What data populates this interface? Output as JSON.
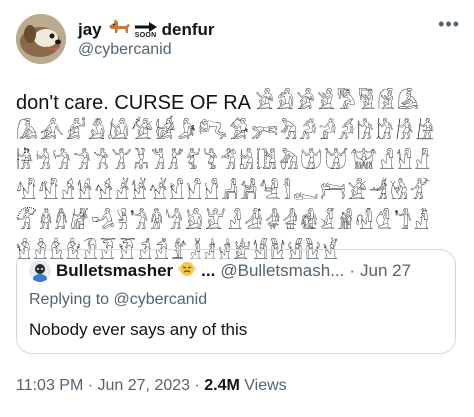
{
  "author": {
    "name": "jay",
    "badge_text": "SOON",
    "name_suffix": "denfur",
    "handle": "@cybercanid",
    "avatar_icon": "dog-photo-avatar",
    "name_icons": [
      "dog-emoji-icon",
      "soon-arrow-icon"
    ]
  },
  "more_icon": "more-options-icon",
  "tweet": {
    "lead_text": "don't care. CURSE OF RA ",
    "hieroglyphs": "𓀀𓀁𓀂𓀃𓀄𓀅𓀆𓀇𓀈𓀉𓀊𓀋𓀌𓀍𓀎𓀏𓀐𓀑𓀒𓀓𓀔𓀕𓀖𓀗𓀘𓀙𓀚𓀛𓀜𓀝𓀞𓀟𓀠𓀡𓀢𓀣𓀤𓀥𓀦𓀧𓀨𓀩𓀪𓀫𓀬𓀭𓀮𓀯𓀰𓀱𓀲𓀳𓀴𓀵𓀶𓀷𓀸𓀹𓀺𓀻𓀼𓀽𓀾𓀿𓁀𓁁𓁂𓁃𓁄𓁅𓁆𓁇𓁈𓁉𓁊𓁋𓁌𓁍𓁎𓁏𓁐𓁑𓁒𓁓𓁔𓁕𓁖𓁗𓁘𓁙𓁚𓁛𓁜𓁝𓁞𓁟𓁠𓁡𓁢𓁣𓁤𓁥𓁦𓁧𓁨𓁩𓁪𓁫𓁬𓁭"
  },
  "quote": {
    "name": "Bulletsmasher",
    "ellipsis": "...",
    "handle": "@Bulletsmash...",
    "separator": "·",
    "date": "Jun 27",
    "replying_prefix": "Replying to ",
    "replying_to": "@cybercanid",
    "body": "Nobody ever says any of this",
    "avatar_icon": "cartoon-avatar",
    "name_icon": "steaming-face-emoji-icon"
  },
  "meta": {
    "time": "11:03 PM",
    "sep1": " · ",
    "date": "Jun 27, 2023",
    "sep2": " · ",
    "views_count": "2.4M",
    "views_label": " Views"
  }
}
